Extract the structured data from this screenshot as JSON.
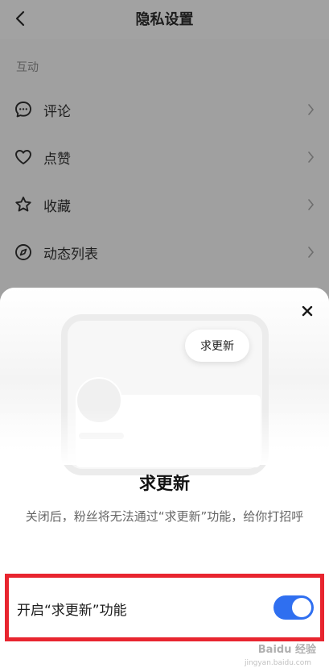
{
  "header": {
    "title": "隐私设置"
  },
  "section": {
    "label": "互动"
  },
  "rows": [
    {
      "label": "评论",
      "icon": "comment-icon"
    },
    {
      "label": "点赞",
      "icon": "heart-icon"
    },
    {
      "label": "收藏",
      "icon": "star-icon"
    },
    {
      "label": "动态列表",
      "icon": "compass-icon"
    }
  ],
  "sheet": {
    "pill_label": "求更新",
    "title": "求更新",
    "description": "关闭后，粉丝将无法通过“求更新”功能，给你打招呼",
    "toggle_label": "开启“求更新”功能",
    "toggle_on": true
  },
  "watermark": {
    "text": "Baidu 经验",
    "sub": "jingyan.baidu.com"
  },
  "colors": {
    "accent": "#2f6ff0",
    "highlight": "#e8252f",
    "overlay": "#a0a0a0"
  }
}
